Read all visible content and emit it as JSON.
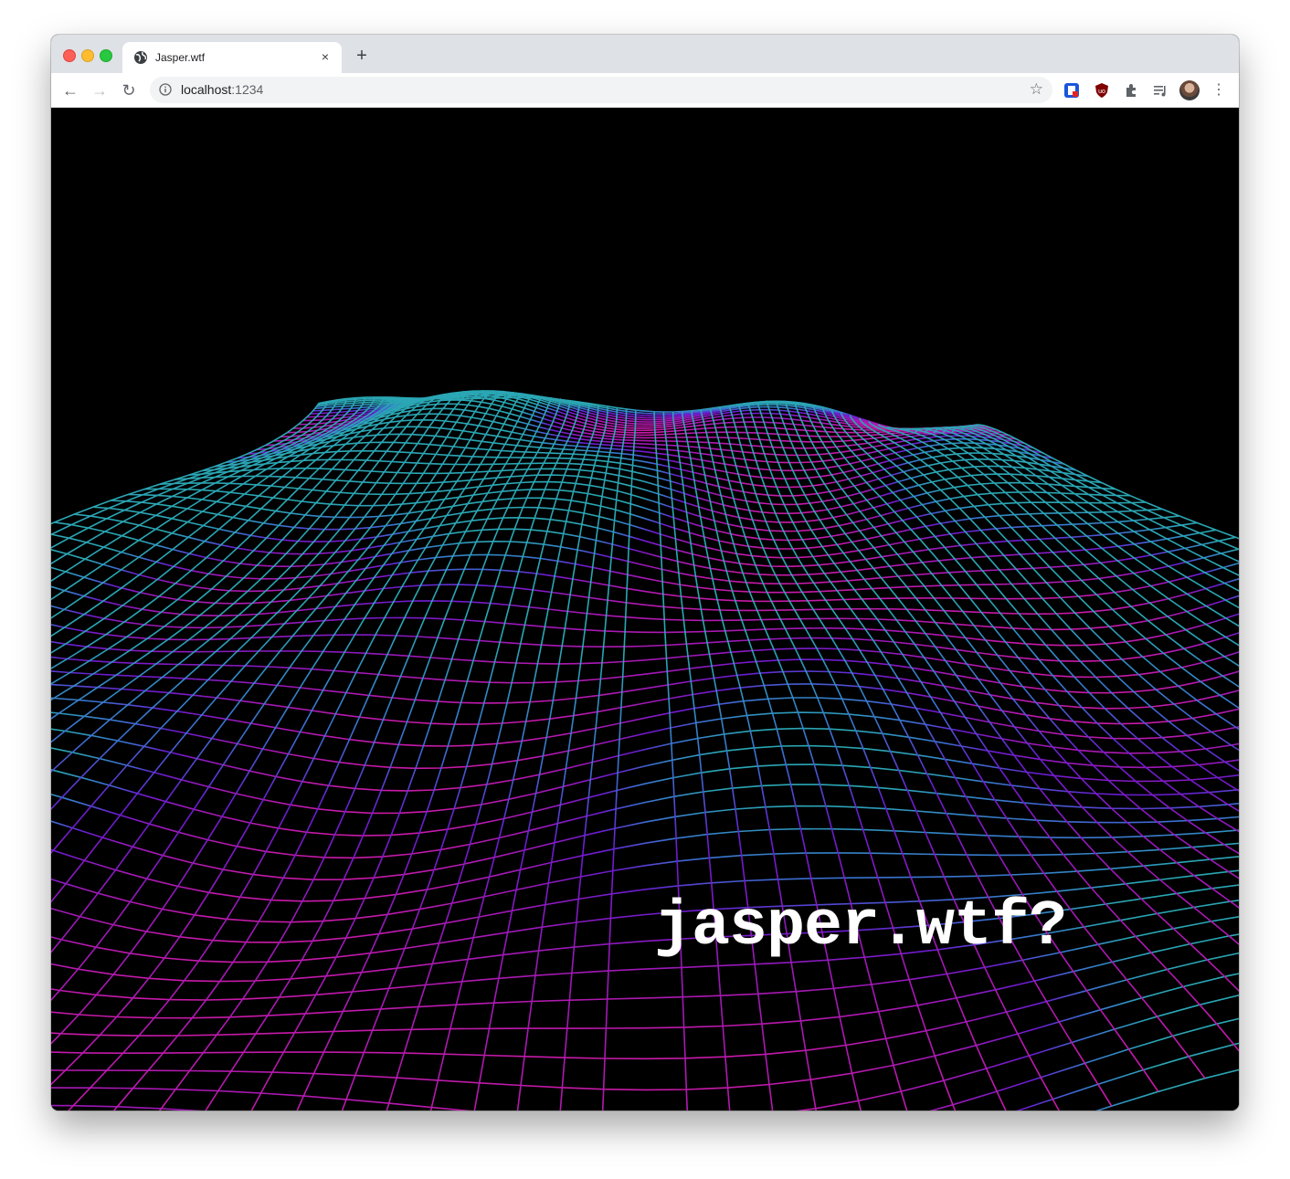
{
  "browser": {
    "tab": {
      "title": "Jasper.wtf",
      "close_glyph": "×",
      "icon": "globe-icon"
    },
    "new_tab_glyph": "+",
    "nav": {
      "back_glyph": "←",
      "forward_glyph": "→",
      "reload_glyph": "↻"
    },
    "address": {
      "host": "localhost",
      "port": ":1234",
      "info_icon": "info-icon"
    },
    "bookmark_glyph": "☆",
    "menu_glyph": "⋮",
    "extensions": [
      "extension-icon",
      "ublock-icon",
      "puzzle-icon",
      "media-icon"
    ],
    "profile_icon": "avatar"
  },
  "page": {
    "headline": "jasper.wtf?",
    "background": "#000000",
    "terrain_colors": {
      "far": "#2aa6b4",
      "mid": "#6a1cd0",
      "near": "#c81aa8"
    },
    "headline_color": "#ffffff"
  }
}
